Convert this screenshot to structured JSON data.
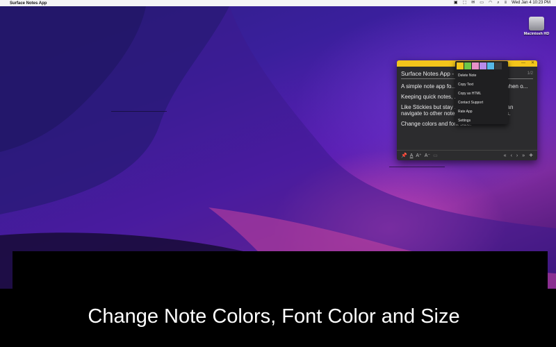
{
  "menubar": {
    "apple_icon": "",
    "app_name": "Surface Notes App",
    "date_time": "Wed Jan 4  10:23 PM"
  },
  "desktop": {
    "drive_label": "Macintosh HD"
  },
  "note": {
    "title_bar_color": "#f3c51b",
    "heading": "Surface Notes App - ...",
    "page_count": "1/2",
    "paragraphs": [
      "A simple note app fo... ...ing research and when o...",
      "Keeping quick notes, ... ...at hand.",
      "Like Stickies but stay ... ...ndows and you can navigate to other notes with left-right arrows.",
      "Change colors and font size."
    ],
    "toolbar": {
      "font_color": "A",
      "font_increase": "A⁺",
      "font_decrease": "A⁻",
      "first": "«",
      "prev": "‹",
      "next": "›",
      "last": "»",
      "add": "+"
    }
  },
  "context_menu": {
    "swatch_colors": [
      "#f3c51b",
      "#6cc64a",
      "#e891c9",
      "#b88be8",
      "#56b8e6",
      "#3a3a3c"
    ],
    "items": [
      "Delete Note",
      "Copy Text",
      "Copy as HTML",
      "Contact Support",
      "Rate App",
      "Settings"
    ]
  },
  "caption": "Change Note Colors, Font Color and Size"
}
